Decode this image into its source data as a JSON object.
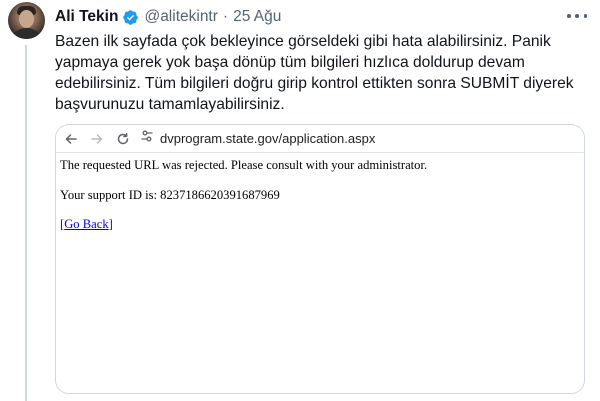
{
  "tweet": {
    "author_name": "Ali Tekin",
    "handle": "@alitekintr",
    "separator": "·",
    "date": "25 Ağu",
    "lines": [
      "Bazen ilk sayfada çok bekleyince görseldeki gibi hata alabilirsiniz. Panik",
      "yapmaya gerek yok başa dönüp tüm bilgileri hızlıca doldurup devam",
      "edebilirsiniz.  Tüm bilgileri doğru girip kontrol ettikten sonra SUBMİT diyerek",
      "başvurunuzu tamamlayabilirsiniz."
    ]
  },
  "colors": {
    "verified": "#1d9bf0",
    "muted": "#536471",
    "link": "#0000ee"
  },
  "browser": {
    "url": "dvprogram.state.gov/application.aspx",
    "icons": [
      "back-arrow-icon",
      "forward-arrow-icon",
      "reload-icon",
      "site-info-icon"
    ]
  },
  "error_page": {
    "message": "The requested URL was rejected. Please consult with your administrator.",
    "support_id_line": "Your support ID is: 8237186620391687969",
    "bracket_open": "[",
    "link_text": "Go Back",
    "bracket_close": "]"
  }
}
